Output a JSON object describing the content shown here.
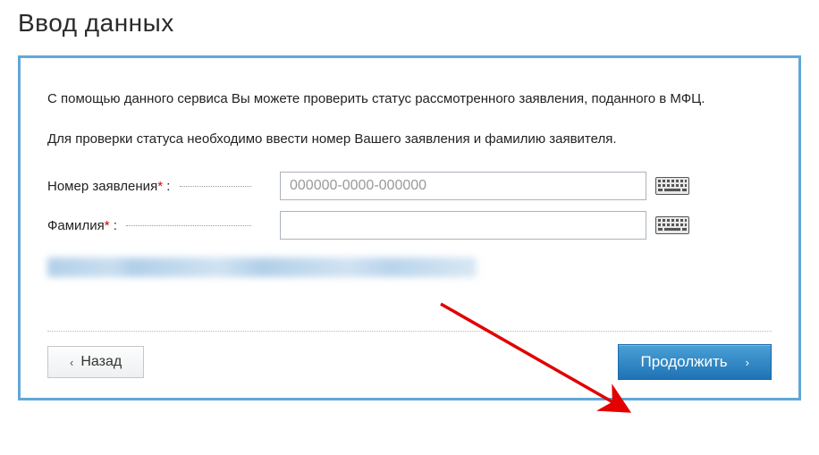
{
  "page": {
    "title": "Ввод данных"
  },
  "description": {
    "line1": "С помощью данного сервиса Вы можете проверить статус рассмотренного заявления, поданного в МФЦ.",
    "line2": "Для проверки статуса необходимо ввести номер Вашего заявления и фамилию заявителя."
  },
  "form": {
    "application_number": {
      "label": "Номер заявления",
      "required_mark": "*",
      "colon": ":",
      "placeholder": "000000-0000-000000",
      "value": ""
    },
    "surname": {
      "label": "Фамилия",
      "required_mark": "*",
      "colon": ":",
      "placeholder": "",
      "value": ""
    }
  },
  "buttons": {
    "back": "Назад",
    "continue": "Продолжить"
  },
  "icons": {
    "keyboard": "keyboard-icon",
    "chevron_left": "‹",
    "chevron_right": "›"
  },
  "colors": {
    "panel_border": "#5fa8d9",
    "required": "#d40000",
    "primary_btn_top": "#4aa0d6",
    "primary_btn_bottom": "#1f73b5",
    "arrow": "#e20000"
  }
}
